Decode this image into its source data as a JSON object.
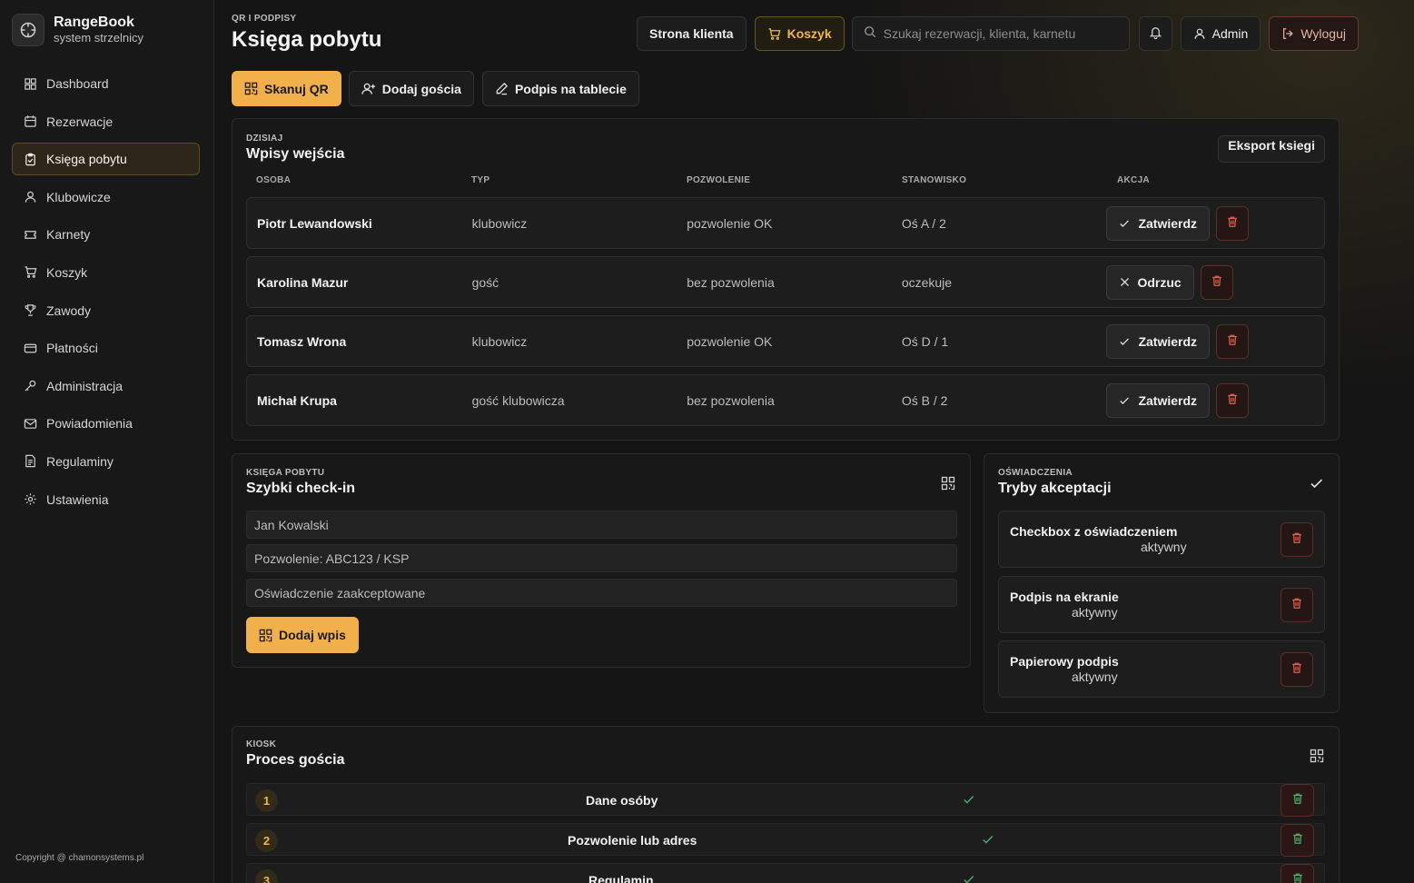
{
  "brand": {
    "name": "RangeBook",
    "subtitle": "system strzelnicy"
  },
  "sidebar": {
    "items": [
      {
        "label": "Dashboard",
        "icon": "grid-icon"
      },
      {
        "label": "Rezerwacje",
        "icon": "calendar-icon"
      },
      {
        "label": "Księga pobytu",
        "icon": "clipboard-icon",
        "active": true
      },
      {
        "label": "Klubowicze",
        "icon": "user-icon"
      },
      {
        "label": "Karnety",
        "icon": "ticket-icon"
      },
      {
        "label": "Koszyk",
        "icon": "cart-icon"
      },
      {
        "label": "Zawody",
        "icon": "trophy-icon"
      },
      {
        "label": "Płatności",
        "icon": "card-icon"
      },
      {
        "label": "Administracja",
        "icon": "key-icon"
      },
      {
        "label": "Powiadomienia",
        "icon": "mail-icon"
      },
      {
        "label": "Regulaminy",
        "icon": "document-icon"
      },
      {
        "label": "Ustawienia",
        "icon": "gear-icon"
      }
    ],
    "copyright": "Copyright @ chamonsystems.pl"
  },
  "header": {
    "breadcrumb": "QR I PODPISY",
    "title": "Księga pobytu",
    "client_page_label": "Strona klienta",
    "cart_label": "Koszyk",
    "search_placeholder": "Szukaj rezerwacji, klienta, karnetu",
    "admin_label": "Admin",
    "logout_label": "Wyloguj"
  },
  "actions": {
    "scan_qr": "Skanuj QR",
    "add_guest": "Dodaj gościa",
    "tablet_sign": "Podpis na tablecie"
  },
  "entries": {
    "kicker": "DZISIAJ",
    "title": "Wpisy wejścia",
    "export_label": "Eksport ksiegi",
    "columns": [
      "OSOBA",
      "TYP",
      "POZWOLENIE",
      "STANOWISKO",
      "AKCJA"
    ],
    "rows": [
      {
        "person": "Piotr Lewandowski",
        "type": "klubowicz",
        "permit": "pozwolenie OK",
        "station": "Oś A / 2",
        "action": "Zatwierdz",
        "action_icon": "check-icon"
      },
      {
        "person": "Karolina Mazur",
        "type": "gość",
        "permit": "bez pozwolenia",
        "station": "oczekuje",
        "action": "Odrzuc",
        "action_icon": "x-icon"
      },
      {
        "person": "Tomasz Wrona",
        "type": "klubowicz",
        "permit": "pozwolenie OK",
        "station": "Oś D / 1",
        "action": "Zatwierdz",
        "action_icon": "check-icon"
      },
      {
        "person": "Michał Krupa",
        "type": "gość klubowicza",
        "permit": "bez pozwolenia",
        "station": "Oś B / 2",
        "action": "Zatwierdz",
        "action_icon": "check-icon"
      }
    ]
  },
  "quick_checkin": {
    "kicker": "KSIĘGA POBYTU",
    "title": "Szybki check-in",
    "fields": [
      "Jan Kowalski",
      "Pozwolenie: ABC123 / KSP",
      "Oświadczenie zaakceptowane"
    ],
    "submit_label": "Dodaj wpis"
  },
  "acceptance_modes": {
    "kicker": "OŚWIADCZENIA",
    "title": "Tryby akceptacji",
    "items": [
      {
        "title": "Checkbox z oświadczeniem",
        "status": "aktywny"
      },
      {
        "title": "Podpis na ekranie",
        "status": "aktywny"
      },
      {
        "title": "Papierowy podpis",
        "status": "aktywny"
      }
    ]
  },
  "guest_process": {
    "kicker": "KIOSK",
    "title": "Proces gościa",
    "steps": [
      {
        "num": "1",
        "label": "Dane osóby"
      },
      {
        "num": "2",
        "label": "Pozwolenie lub adres"
      },
      {
        "num": "3",
        "label": "Regulamin"
      }
    ]
  },
  "colors": {
    "accent": "#f2b04b",
    "danger": "#e0614a",
    "success": "#4caf6a"
  }
}
